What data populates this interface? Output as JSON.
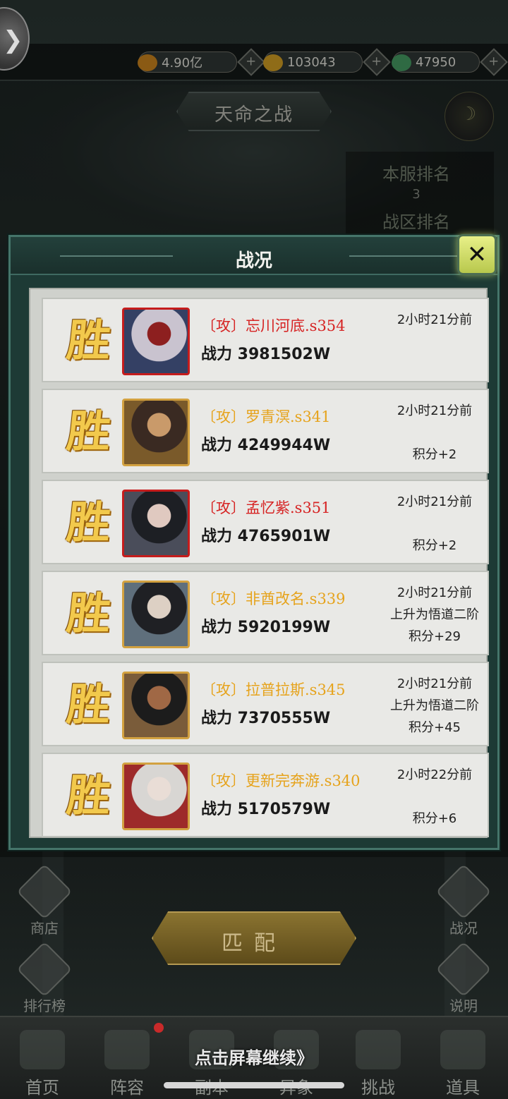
{
  "top_bar": {
    "resources": [
      {
        "name": "copper-coin",
        "value": "4.90亿",
        "color": "#c98a1f"
      },
      {
        "name": "gold-ingot",
        "value": "103043",
        "color": "#d4a322"
      },
      {
        "name": "jade-token",
        "value": "47950",
        "color": "#4c9a63"
      }
    ]
  },
  "banner": {
    "title": "天命之战"
  },
  "ranking": {
    "server_rank_label": "本服排名",
    "server_rank_value": "3",
    "zone_rank_label": "战区排名"
  },
  "modal": {
    "title": "战况",
    "close_label": "✕",
    "rows": [
      {
        "result": "胜",
        "name": "〔攻〕忘川河底.s354",
        "name_color": "#d62323",
        "portrait_frame": "red",
        "power": "战力 3981502W",
        "time": "2小时21分前",
        "detail1": "",
        "detail2": "",
        "portrait_palette": [
          "#c9c3cf",
          "#8d1f1f",
          "#344064"
        ]
      },
      {
        "result": "胜",
        "name": "〔攻〕罗青溟.s341",
        "name_color": "#e6a31c",
        "portrait_frame": "gold",
        "power": "战力 4249944W",
        "time": "2小时21分前",
        "detail1": "",
        "detail2": "积分+2",
        "portrait_palette": [
          "#3a2a22",
          "#c99a6a",
          "#7a5a2a"
        ]
      },
      {
        "result": "胜",
        "name": "〔攻〕孟忆紫.s351",
        "name_color": "#d62323",
        "portrait_frame": "red",
        "power": "战力 4765901W",
        "time": "2小时21分前",
        "detail1": "",
        "detail2": "积分+2",
        "portrait_palette": [
          "#1d1f24",
          "#e0c9c0",
          "#4a4d5a"
        ]
      },
      {
        "result": "胜",
        "name": "〔攻〕非酋改名.s339",
        "name_color": "#e6a31c",
        "portrait_frame": "gold",
        "power": "战力 5920199W",
        "time": "2小时21分前",
        "detail1": "上升为悟道二阶",
        "detail2": "积分+29",
        "portrait_palette": [
          "#1f2024",
          "#ddd0c4",
          "#5f6f7c"
        ]
      },
      {
        "result": "胜",
        "name": "〔攻〕拉普拉斯.s345",
        "name_color": "#e6a31c",
        "portrait_frame": "gold",
        "power": "战力 7370555W",
        "time": "2小时21分前",
        "detail1": "上升为悟道二阶",
        "detail2": "积分+45",
        "portrait_palette": [
          "#1c1c1c",
          "#a06845",
          "#7a5c3a"
        ]
      },
      {
        "result": "胜",
        "name": "〔攻〕更新完奔游.s340",
        "name_color": "#e6a31c",
        "portrait_frame": "gold",
        "power": "战力 5170579W",
        "time": "2小时22分前",
        "detail1": "",
        "detail2": "积分+6",
        "portrait_palette": [
          "#d8d6d3",
          "#e9ddd6",
          "#9d2a2a"
        ]
      }
    ]
  },
  "side_buttons": {
    "shop": "商店",
    "leaderboard": "排行榜",
    "battle_log": "战况",
    "help": "说明"
  },
  "match_button": "匹配",
  "continue_hint": "点击屏幕继续》",
  "bottom_nav": [
    "首页",
    "阵容",
    "副本",
    "异象",
    "挑战",
    "道具"
  ]
}
